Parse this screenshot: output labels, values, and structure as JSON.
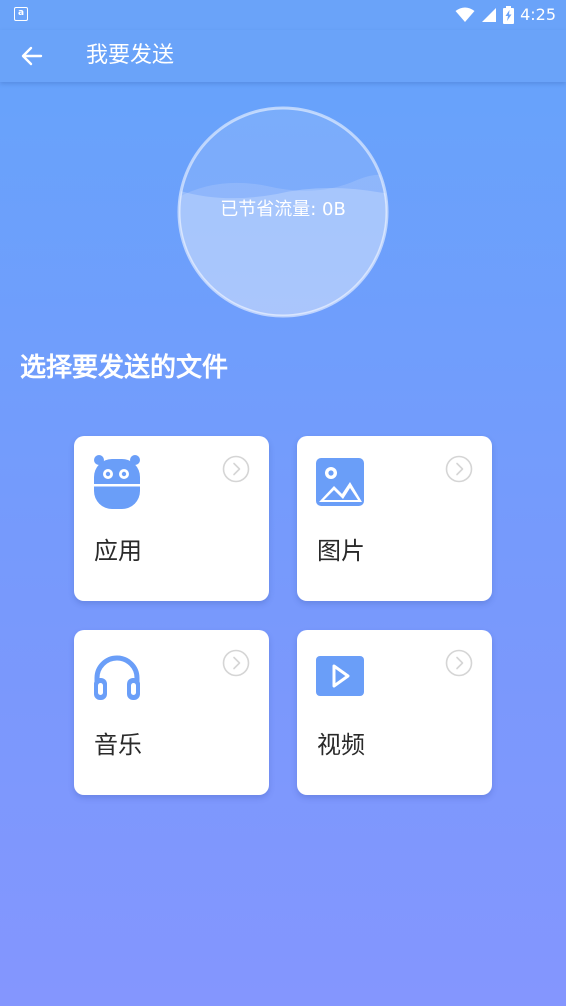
{
  "status_bar": {
    "notification_icon": "a",
    "time": "4:25",
    "icons": [
      "wifi-icon",
      "signal-icon",
      "battery-charging-icon"
    ]
  },
  "app_bar": {
    "title": "我要发送",
    "back_icon": "arrow-left-icon"
  },
  "summary": {
    "saved_label": "已节省流量: 0B"
  },
  "section": {
    "title": "选择要发送的文件"
  },
  "categories": [
    {
      "label": "应用",
      "icon": "app-robot-icon"
    },
    {
      "label": "图片",
      "icon": "image-icon"
    },
    {
      "label": "音乐",
      "icon": "headphones-icon"
    },
    {
      "label": "视频",
      "icon": "video-play-icon"
    }
  ],
  "colors": {
    "background_top": "#65a4fb",
    "background_bottom": "#8496fe",
    "icon_blue": "#6a9ef8",
    "chevron_gray": "#d5d5d5",
    "card_bg": "#ffffff"
  }
}
